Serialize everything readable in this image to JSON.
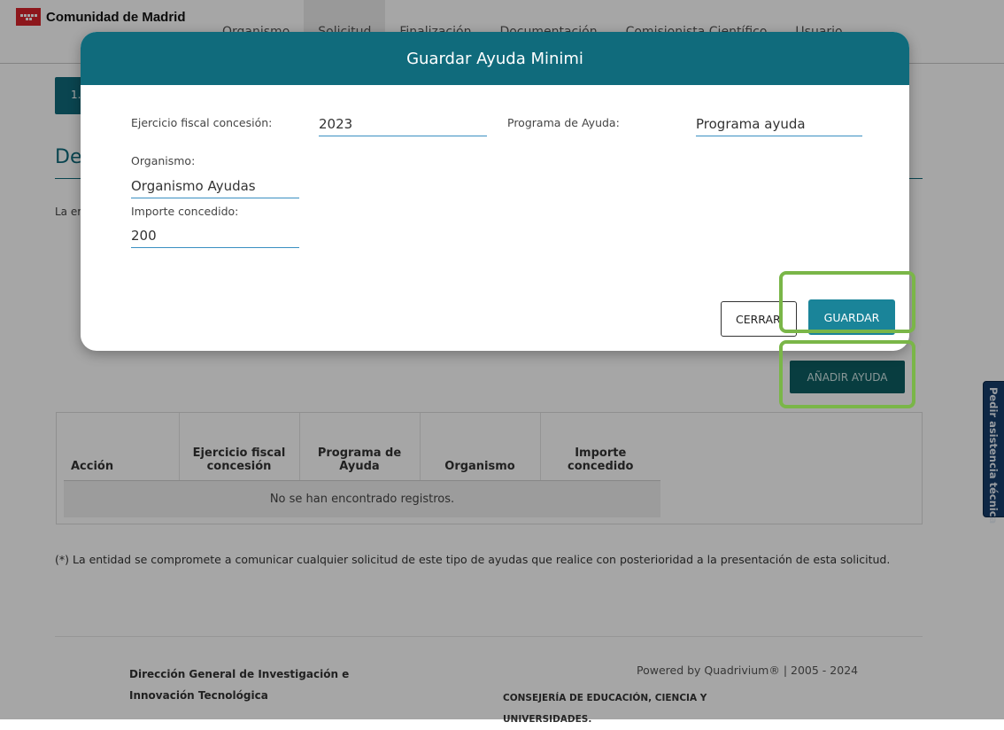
{
  "header": {
    "brand": "Comunidad de Madrid",
    "nav": [
      "Organismo",
      "Solicitud",
      "Finalización",
      "Documentación",
      "Comisionista Científico",
      "Usuario"
    ]
  },
  "page": {
    "step_chip": "1.",
    "section_title": "De",
    "section_text": "La er",
    "add_button": "AÑADIR AYUDA"
  },
  "table": {
    "headers": {
      "accion": "Acción",
      "ejercicio": "Ejercicio fiscal concesión",
      "programa": "Programa de Ayuda",
      "organismo": "Organismo",
      "importe": "Importe concedido"
    },
    "empty_message": "No se han encontrado registros."
  },
  "footnote": "(*) La entidad se compromete a comunicar cualquier solicitud de este tipo de ayudas que realice con posterioridad a la presentación de esta solicitud.",
  "footer": {
    "left": "Dirección General de Investigación e Innovación Tecnológica",
    "powered": "Powered by Quadrivium® | 2005 - 2024",
    "ministry": "CONSEJERÍA DE EDUCACIÓN, CIENCIA Y UNIVERSIDADES."
  },
  "help_tab": "Pedir asistencia técnica",
  "modal": {
    "title": "Guardar Ayuda Minimi",
    "fields": {
      "ejercicio_label": "Ejercicio fiscal concesión:",
      "ejercicio_value": "2023",
      "programa_label": "Programa de Ayuda:",
      "programa_value": "Programa ayuda",
      "organismo_label": "Organismo:",
      "organismo_value": "Organismo Ayudas",
      "importe_label": "Importe concedido:",
      "importe_value": "200"
    },
    "cerrar_label": "CERRAR",
    "guardar_label": "GUARDAR"
  },
  "colors": {
    "primary": "#106b7c",
    "button": "#1a8499",
    "highlight": "#7ab648",
    "help_tab": "#163d6a",
    "brand_red": "#d9242b"
  }
}
